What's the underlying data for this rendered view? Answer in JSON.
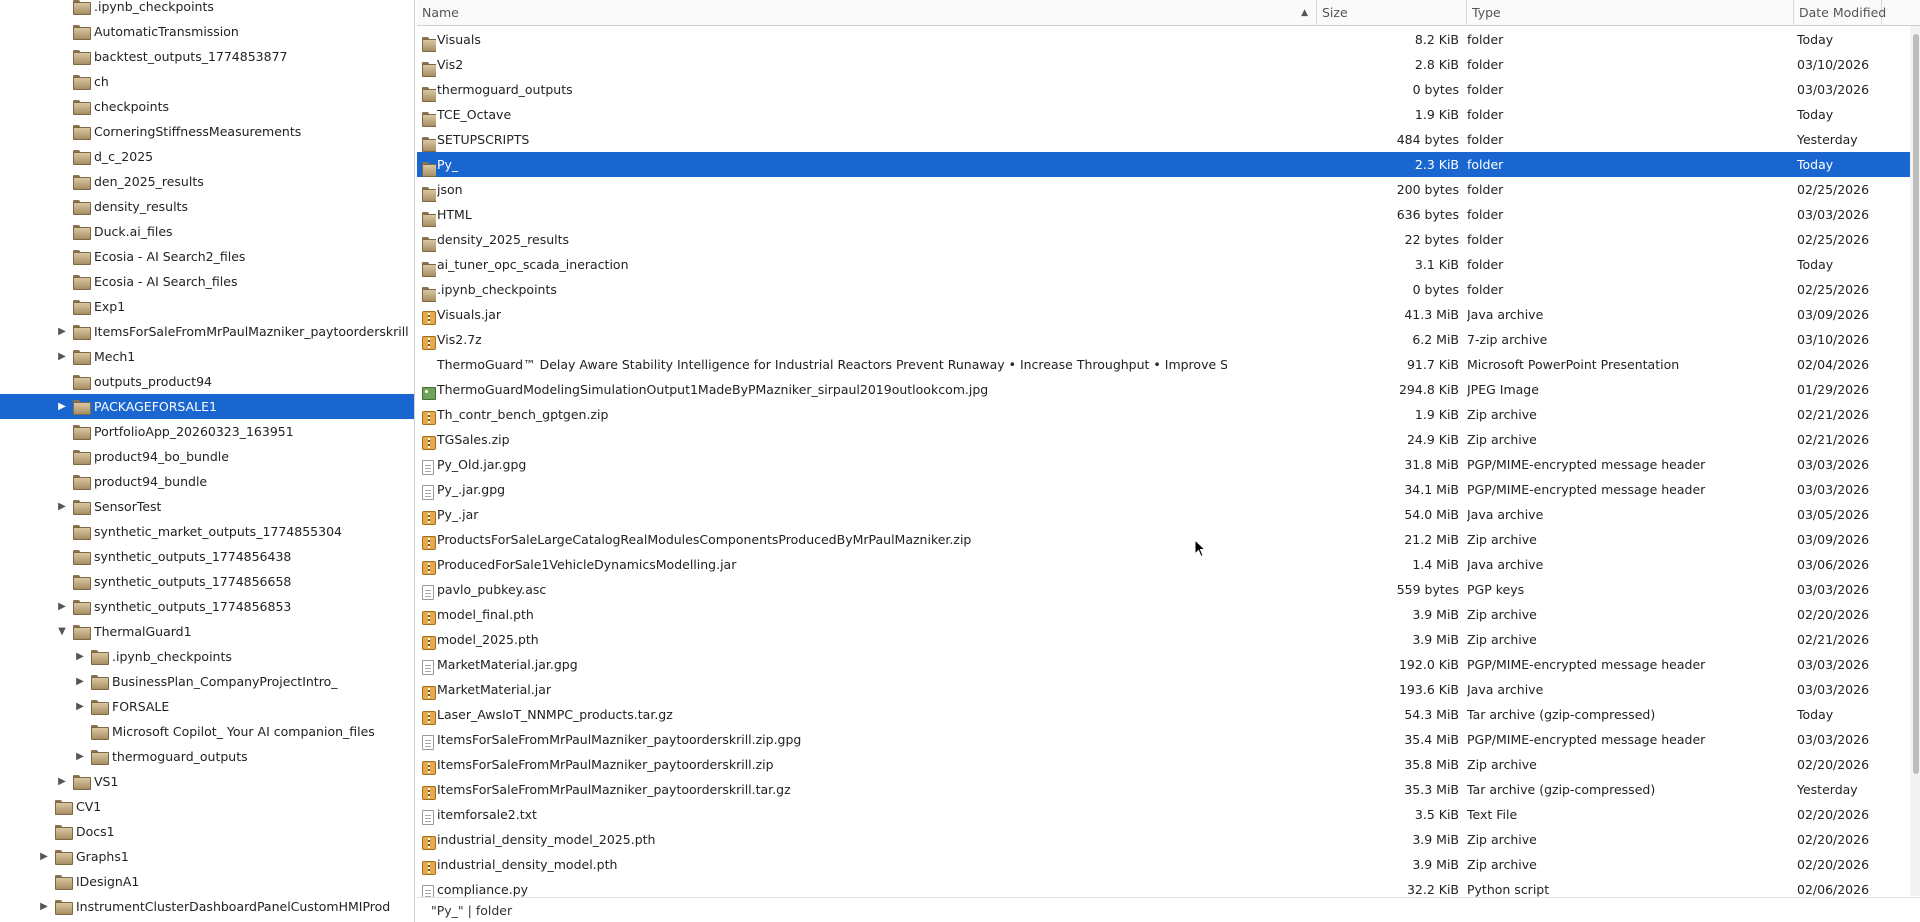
{
  "tree": {
    "items": [
      {
        "label": ".ipynb_checkpoints",
        "depth": 2,
        "arrow": "",
        "selected": false
      },
      {
        "label": "AutomaticTransmission",
        "depth": 2,
        "arrow": "",
        "selected": false
      },
      {
        "label": "backtest_outputs_1774853877",
        "depth": 2,
        "arrow": "",
        "selected": false
      },
      {
        "label": "ch",
        "depth": 2,
        "arrow": "",
        "selected": false
      },
      {
        "label": "checkpoints",
        "depth": 2,
        "arrow": "",
        "selected": false
      },
      {
        "label": "CorneringStiffnessMeasurements",
        "depth": 2,
        "arrow": "",
        "selected": false
      },
      {
        "label": "d_c_2025",
        "depth": 2,
        "arrow": "",
        "selected": false
      },
      {
        "label": "den_2025_results",
        "depth": 2,
        "arrow": "",
        "selected": false
      },
      {
        "label": "density_results",
        "depth": 2,
        "arrow": "",
        "selected": false
      },
      {
        "label": "Duck.ai_files",
        "depth": 2,
        "arrow": "",
        "selected": false
      },
      {
        "label": "Ecosia - AI Search2_files",
        "depth": 2,
        "arrow": "",
        "selected": false
      },
      {
        "label": "Ecosia - AI Search_files",
        "depth": 2,
        "arrow": "",
        "selected": false
      },
      {
        "label": "Exp1",
        "depth": 2,
        "arrow": "",
        "selected": false
      },
      {
        "label": "ItemsForSaleFromMrPaulMazniker_paytoorderskrill",
        "depth": 2,
        "arrow": "collapsed",
        "selected": false
      },
      {
        "label": "Mech1",
        "depth": 2,
        "arrow": "collapsed",
        "selected": false
      },
      {
        "label": "outputs_product94",
        "depth": 2,
        "arrow": "",
        "selected": false
      },
      {
        "label": "PACKAGEFORSALE1",
        "depth": 2,
        "arrow": "collapsed",
        "selected": true
      },
      {
        "label": "PortfolioApp_20260323_163951",
        "depth": 2,
        "arrow": "",
        "selected": false
      },
      {
        "label": "product94_bo_bundle",
        "depth": 2,
        "arrow": "",
        "selected": false
      },
      {
        "label": "product94_bundle",
        "depth": 2,
        "arrow": "",
        "selected": false
      },
      {
        "label": "SensorTest",
        "depth": 2,
        "arrow": "collapsed",
        "selected": false
      },
      {
        "label": "synthetic_market_outputs_1774855304",
        "depth": 2,
        "arrow": "",
        "selected": false
      },
      {
        "label": "synthetic_outputs_1774856438",
        "depth": 2,
        "arrow": "",
        "selected": false
      },
      {
        "label": "synthetic_outputs_1774856658",
        "depth": 2,
        "arrow": "",
        "selected": false
      },
      {
        "label": "synthetic_outputs_1774856853",
        "depth": 2,
        "arrow": "collapsed",
        "selected": false
      },
      {
        "label": "ThermalGuard1",
        "depth": 2,
        "arrow": "expanded",
        "selected": false
      },
      {
        "label": ".ipynb_checkpoints",
        "depth": 3,
        "arrow": "collapsed",
        "selected": false
      },
      {
        "label": "BusinessPlan_CompanyProjectIntro_",
        "depth": 3,
        "arrow": "collapsed",
        "selected": false
      },
      {
        "label": "FORSALE",
        "depth": 3,
        "arrow": "collapsed",
        "selected": false
      },
      {
        "label": "Microsoft Copilot_ Your AI companion_files",
        "depth": 3,
        "arrow": "",
        "selected": false
      },
      {
        "label": "thermoguard_outputs",
        "depth": 3,
        "arrow": "collapsed",
        "selected": false
      },
      {
        "label": "VS1",
        "depth": 2,
        "arrow": "collapsed",
        "selected": false
      },
      {
        "label": "CV1",
        "depth": 1,
        "arrow": "",
        "selected": false
      },
      {
        "label": "Docs1",
        "depth": 1,
        "arrow": "",
        "selected": false
      },
      {
        "label": "Graphs1",
        "depth": 1,
        "arrow": "collapsed",
        "selected": false
      },
      {
        "label": "IDesignA1",
        "depth": 1,
        "arrow": "",
        "selected": false
      },
      {
        "label": "InstrumentClusterDashboardPanelCustomHMIProd",
        "depth": 1,
        "arrow": "collapsed",
        "selected": false
      }
    ]
  },
  "list": {
    "columns": {
      "name": "Name",
      "size": "Size",
      "type": "Type",
      "date": "Date Modified"
    },
    "rows": [
      {
        "name": "Visuals",
        "size": "8.2 KiB",
        "type": "folder",
        "date": "Today",
        "icon": "folder-icon",
        "selected": false
      },
      {
        "name": "Vis2",
        "size": "2.8 KiB",
        "type": "folder",
        "date": "03/10/2026",
        "icon": "folder-icon",
        "selected": false
      },
      {
        "name": "thermoguard_outputs",
        "size": "0 bytes",
        "type": "folder",
        "date": "03/03/2026",
        "icon": "folder-icon",
        "selected": false
      },
      {
        "name": "TCE_Octave",
        "size": "1.9 KiB",
        "type": "folder",
        "date": "Today",
        "icon": "folder-icon",
        "selected": false
      },
      {
        "name": "SETUPSCRIPTS",
        "size": "484 bytes",
        "type": "folder",
        "date": "Yesterday",
        "icon": "folder-icon",
        "selected": false
      },
      {
        "name": "Py_",
        "size": "2.3 KiB",
        "type": "folder",
        "date": "Today",
        "icon": "folder-icon",
        "selected": true
      },
      {
        "name": "json",
        "size": "200 bytes",
        "type": "folder",
        "date": "02/25/2026",
        "icon": "folder-icon",
        "selected": false
      },
      {
        "name": "HTML",
        "size": "636 bytes",
        "type": "folder",
        "date": "03/03/2026",
        "icon": "folder-icon",
        "selected": false
      },
      {
        "name": "density_2025_results",
        "size": "22 bytes",
        "type": "folder",
        "date": "02/25/2026",
        "icon": "folder-icon",
        "selected": false
      },
      {
        "name": "ai_tuner_opc_scada_ineraction",
        "size": "3.1 KiB",
        "type": "folder",
        "date": "Today",
        "icon": "folder-icon",
        "selected": false
      },
      {
        "name": ".ipynb_checkpoints",
        "size": "0 bytes",
        "type": "folder",
        "date": "02/25/2026",
        "icon": "folder-icon",
        "selected": false
      },
      {
        "name": "Visuals.jar",
        "size": "41.3 MiB",
        "type": "Java archive",
        "date": "03/09/2026",
        "icon": "archive-icon",
        "selected": false
      },
      {
        "name": "Vis2.7z",
        "size": "6.2 MiB",
        "type": "7-zip archive",
        "date": "03/10/2026",
        "icon": "archive-icon",
        "selected": false
      },
      {
        "name": "ThermoGuard™ Delay Aware Stability Intelligence for Industrial Reactors Prevent Runaway • Increase Throughput • Improve Safety.pptx",
        "size": "91.7 KiB",
        "type": "Microsoft PowerPoint Presentation",
        "date": "02/04/2026",
        "icon": "none",
        "selected": false
      },
      {
        "name": "ThermoGuardModelingSimulationOutput1MadeByPMazniker_sirpaul2019outlookcom.jpg",
        "size": "294.8 KiB",
        "type": "JPEG Image",
        "date": "01/29/2026",
        "icon": "image-icon",
        "selected": false
      },
      {
        "name": "Th_contr_bench_gptgen.zip",
        "size": "1.9 KiB",
        "type": "Zip archive",
        "date": "02/21/2026",
        "icon": "archive-icon",
        "selected": false
      },
      {
        "name": "TGSales.zip",
        "size": "24.9 KiB",
        "type": "Zip archive",
        "date": "02/21/2026",
        "icon": "archive-icon",
        "selected": false
      },
      {
        "name": "Py_Old.jar.gpg",
        "size": "31.8 MiB",
        "type": "PGP/MIME-encrypted message header",
        "date": "03/03/2026",
        "icon": "document-icon",
        "selected": false
      },
      {
        "name": "Py_.jar.gpg",
        "size": "34.1 MiB",
        "type": "PGP/MIME-encrypted message header",
        "date": "03/03/2026",
        "icon": "document-icon",
        "selected": false
      },
      {
        "name": "Py_.jar",
        "size": "54.0 MiB",
        "type": "Java archive",
        "date": "03/05/2026",
        "icon": "archive-icon",
        "selected": false
      },
      {
        "name": "ProductsForSaleLargeCatalogRealModulesComponentsProducedByMrPaulMazniker.zip",
        "size": "21.2 MiB",
        "type": "Zip archive",
        "date": "03/09/2026",
        "icon": "archive-icon",
        "selected": false
      },
      {
        "name": "ProducedForSale1VehicleDynamicsModelling.jar",
        "size": "1.4 MiB",
        "type": "Java archive",
        "date": "03/06/2026",
        "icon": "archive-icon",
        "selected": false
      },
      {
        "name": "pavlo_pubkey.asc",
        "size": "559 bytes",
        "type": "PGP keys",
        "date": "03/03/2026",
        "icon": "document-icon",
        "selected": false
      },
      {
        "name": "model_final.pth",
        "size": "3.9 MiB",
        "type": "Zip archive",
        "date": "02/20/2026",
        "icon": "archive-icon",
        "selected": false
      },
      {
        "name": "model_2025.pth",
        "size": "3.9 MiB",
        "type": "Zip archive",
        "date": "02/21/2026",
        "icon": "archive-icon",
        "selected": false
      },
      {
        "name": "MarketMaterial.jar.gpg",
        "size": "192.0 KiB",
        "type": "PGP/MIME-encrypted message header",
        "date": "03/03/2026",
        "icon": "document-icon",
        "selected": false
      },
      {
        "name": "MarketMaterial.jar",
        "size": "193.6 KiB",
        "type": "Java archive",
        "date": "03/03/2026",
        "icon": "archive-icon",
        "selected": false
      },
      {
        "name": "Laser_AwsIoT_NNMPC_products.tar.gz",
        "size": "54.3 MiB",
        "type": "Tar archive (gzip-compressed)",
        "date": "Today",
        "icon": "archive-icon",
        "selected": false
      },
      {
        "name": "ItemsForSaleFromMrPaulMazniker_paytoorderskrill.zip.gpg",
        "size": "35.4 MiB",
        "type": "PGP/MIME-encrypted message header",
        "date": "03/03/2026",
        "icon": "document-icon",
        "selected": false
      },
      {
        "name": "ItemsForSaleFromMrPaulMazniker_paytoorderskrill.zip",
        "size": "35.8 MiB",
        "type": "Zip archive",
        "date": "02/20/2026",
        "icon": "archive-icon",
        "selected": false
      },
      {
        "name": "ItemsForSaleFromMrPaulMazniker_paytoorderskrill.tar.gz",
        "size": "35.3 MiB",
        "type": "Tar archive (gzip-compressed)",
        "date": "Yesterday",
        "icon": "archive-icon",
        "selected": false
      },
      {
        "name": "itemforsale2.txt",
        "size": "3.5 KiB",
        "type": "Text File",
        "date": "02/20/2026",
        "icon": "document-icon",
        "selected": false
      },
      {
        "name": "industrial_density_model_2025.pth",
        "size": "3.9 MiB",
        "type": "Zip archive",
        "date": "02/20/2026",
        "icon": "archive-icon",
        "selected": false
      },
      {
        "name": "industrial_density_model.pth",
        "size": "3.9 MiB",
        "type": "Zip archive",
        "date": "02/20/2026",
        "icon": "archive-icon",
        "selected": false
      },
      {
        "name": "compliance.py",
        "size": "32.2 KiB",
        "type": "Python script",
        "date": "02/06/2026",
        "icon": "document-icon",
        "selected": false
      }
    ]
  },
  "status": {
    "text": "\"Py_\"  |  folder"
  },
  "colors": {
    "selection": "#1a66d0",
    "folder": "#b39a6d",
    "archive": "#e7a94a"
  }
}
